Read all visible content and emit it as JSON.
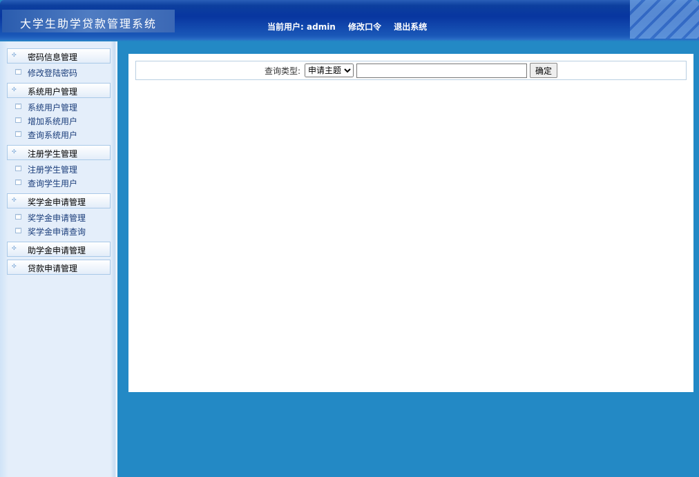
{
  "header": {
    "title": "大学生助学贷款管理系统",
    "current_user_label": "当前用户:",
    "username": "admin",
    "change_password": "修改口令",
    "logout": "退出系统"
  },
  "sidebar": {
    "groups": [
      {
        "label": "密码信息管理",
        "items": [
          "修改登陆密码"
        ]
      },
      {
        "label": "系统用户管理",
        "items": [
          "系统用户管理",
          "增加系统用户",
          "查询系统用户"
        ]
      },
      {
        "label": "注册学生管理",
        "items": [
          "注册学生管理",
          "查询学生用户"
        ]
      },
      {
        "label": "奖学金申请管理",
        "items": [
          "奖学金申请管理",
          "奖学金申请查询"
        ]
      },
      {
        "label": "助学金申请管理",
        "items": []
      },
      {
        "label": "贷款申请管理",
        "items": []
      }
    ]
  },
  "query": {
    "label": "查询类型:",
    "selected": "申请主题",
    "input_value": "",
    "submit": "确定"
  }
}
